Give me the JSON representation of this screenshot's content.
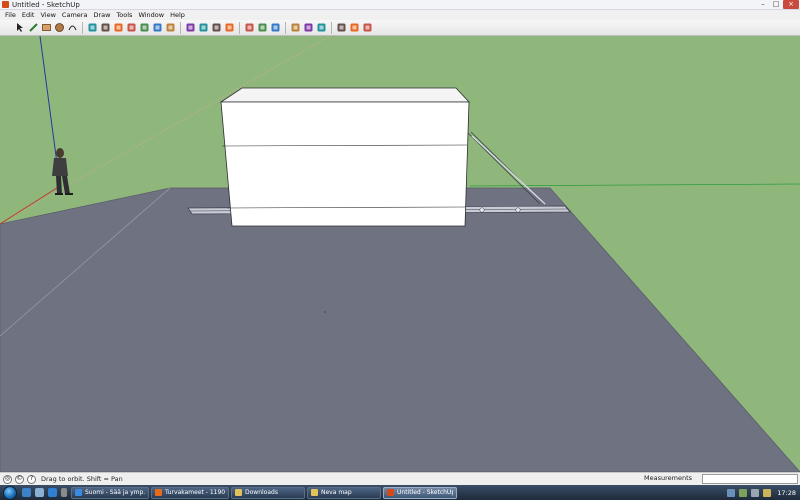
{
  "window": {
    "title": "Untitled - SketchUp"
  },
  "menubar": {
    "items": [
      "File",
      "Edit",
      "View",
      "Camera",
      "Draw",
      "Tools",
      "Window",
      "Help"
    ]
  },
  "toolbar": {
    "groups": [
      [
        "select-tool",
        "pencil-tool",
        "rectangle-tool",
        "circle-tool",
        "arc-tool"
      ],
      [
        "eraser-tool",
        "paint-bucket-tool",
        "push-pull-tool",
        "move-tool",
        "rotate-tool",
        "follow-me-tool",
        "offset-tool"
      ],
      [
        "orbit-tool",
        "pan-tool",
        "zoom-tool",
        "zoom-extents-tool"
      ],
      [
        "components-tool",
        "get-models-tool",
        "share-model-tool"
      ],
      [
        "place-model-tool",
        "add-location-tool",
        "toggle-terrain-tool"
      ],
      [
        "photo-texture-tool",
        "get-current-view-tool",
        "google-earth-tool"
      ]
    ]
  },
  "viewport": {
    "colors": {
      "sky_ground": "#8fb77c",
      "floor": "#6f7281",
      "floor_edge": "#9fa2ae",
      "box_face": "#ffffff",
      "box_top": "#f4f4f4",
      "axis_red": "#c0392b",
      "axis_green": "#2e9b3e",
      "axis_blue": "#233a9e"
    }
  },
  "statusbar": {
    "message": "Drag to orbit.  Shift = Pan",
    "measurements_label": "Measurements"
  },
  "taskbar": {
    "tasks": [
      {
        "label": "Suomi - Sää ja ymp...",
        "active": false
      },
      {
        "label": "Turvakameet - 1190 ...",
        "active": false
      },
      {
        "label": "Downloads",
        "active": false
      },
      {
        "label": "Neva map",
        "active": false
      },
      {
        "label": "Untitled - SketchUp",
        "active": true
      }
    ],
    "clock": "17:28"
  }
}
